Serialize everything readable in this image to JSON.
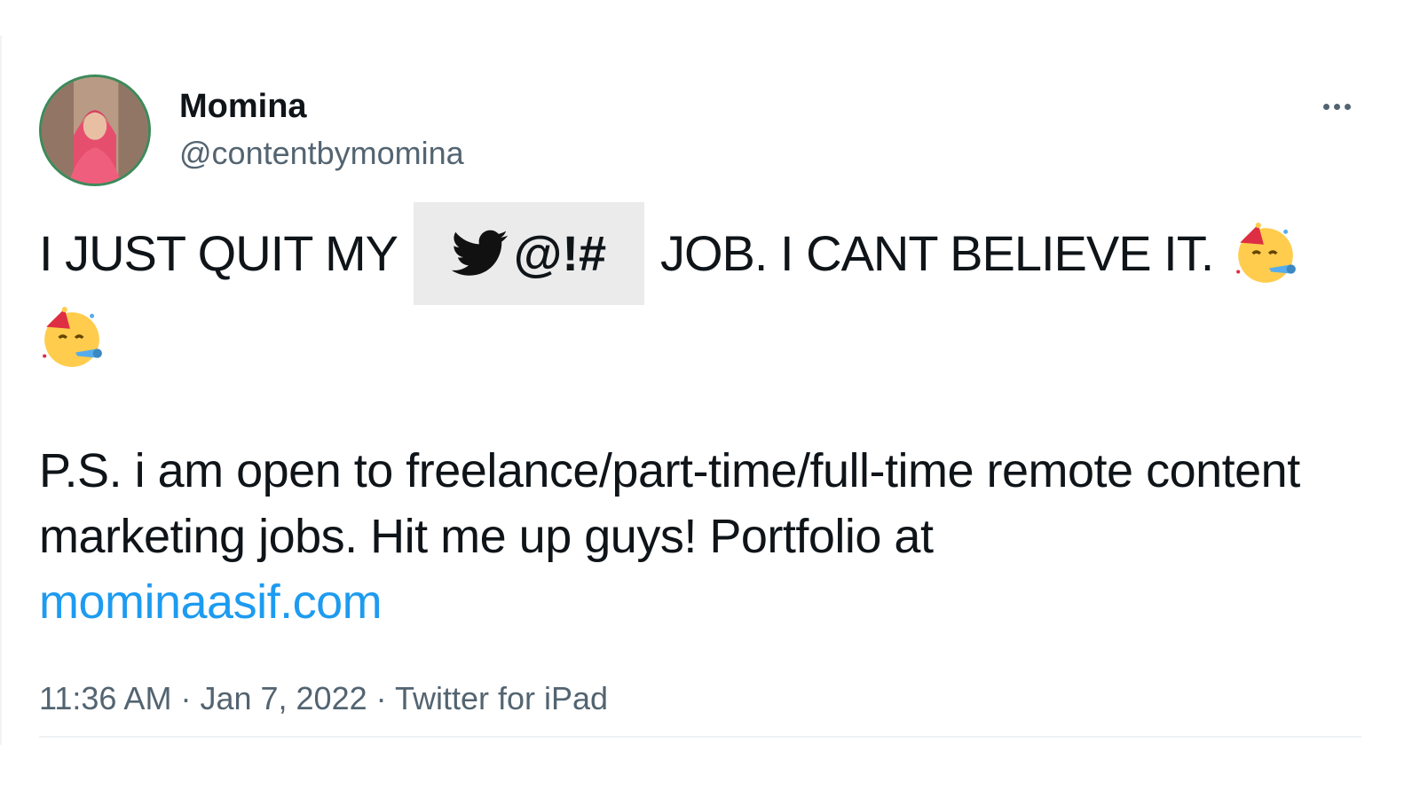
{
  "tweet": {
    "display_name": "Momina",
    "handle": "@contentbymomina",
    "more_icon": "more-horizontal-icon",
    "line1_before": "I JUST QUIT MY",
    "censored_text": "@!#",
    "censored_icon": "twitter-bird-icon",
    "line1_after": "JOB. I CANT BELIEVE IT.",
    "emoji_name": "partying-face-icon",
    "body": "P.S. i am open to freelance/part-time/full-time remote content marketing jobs. Hit me up guys! Portfolio at",
    "link": "mominaasif.com",
    "time": "11:36 AM",
    "date": "Jan 7, 2022",
    "source": "Twitter for iPad",
    "separator": "·"
  },
  "colors": {
    "text": "#0f1419",
    "secondary": "#536471",
    "link": "#1d9bf0",
    "avatar_ring": "#3d8a5a"
  }
}
